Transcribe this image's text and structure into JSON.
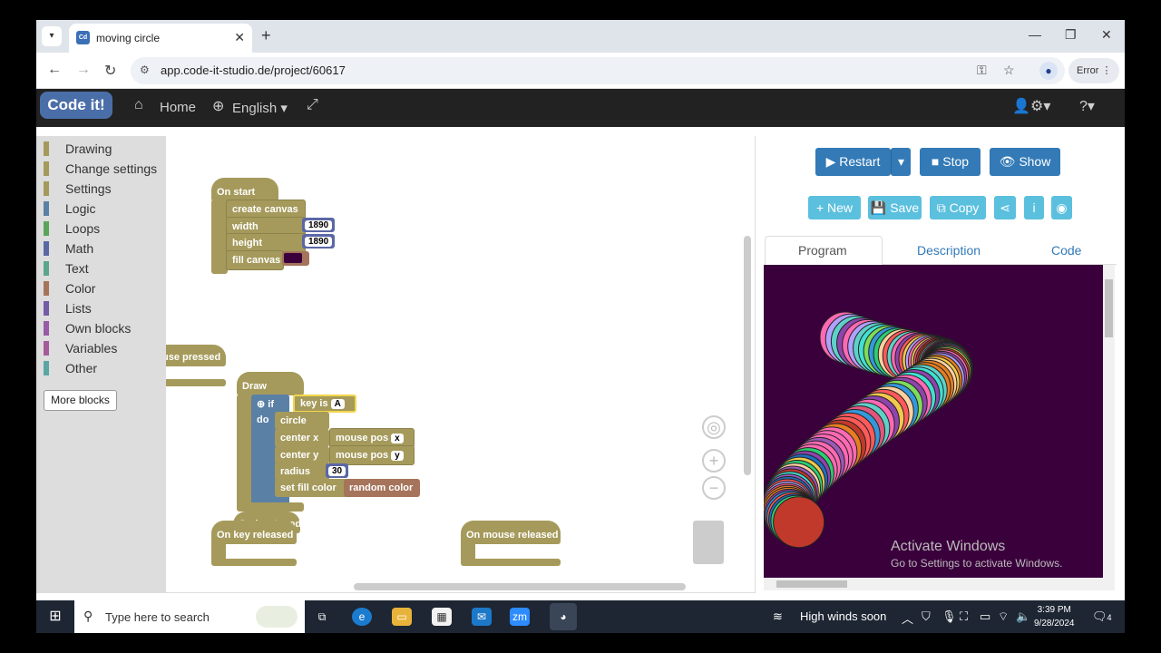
{
  "browser": {
    "tab_title": "moving circle",
    "url": "app.code-it-studio.de/project/60617",
    "error_label": "Error"
  },
  "appbar": {
    "logo": "Code it!",
    "home": "Home",
    "language": "English"
  },
  "toolbox": {
    "categories": [
      {
        "label": "Drawing",
        "color": "#a59a5b"
      },
      {
        "label": "Change settings",
        "color": "#a59a5b"
      },
      {
        "label": "Settings",
        "color": "#a59a5b"
      },
      {
        "label": "Logic",
        "color": "#5b80a5"
      },
      {
        "label": "Loops",
        "color": "#5ba55b"
      },
      {
        "label": "Math",
        "color": "#5b67a5"
      },
      {
        "label": "Text",
        "color": "#5ba58c"
      },
      {
        "label": "Color",
        "color": "#a5745b"
      },
      {
        "label": "Lists",
        "color": "#745ba5"
      },
      {
        "label": "Own blocks",
        "color": "#995ba5"
      },
      {
        "label": "Variables",
        "color": "#a55b99"
      },
      {
        "label": "Other",
        "color": "#5ba5a5"
      }
    ],
    "more_blocks": "More blocks"
  },
  "workspace": {
    "on_start": "On start",
    "create_canvas": "create canvas",
    "width": "width",
    "width_value": "1890",
    "height": "height",
    "height_value": "1890",
    "fill_canvas": "fill canvas",
    "mouse_pressed": "use pressed",
    "draw": "Draw",
    "if": "if",
    "key_is": "key is",
    "key_value": "A",
    "do": "do",
    "circle": "circle",
    "center_x": "center x",
    "center_y": "center y",
    "mouse_pos": "mouse pos",
    "mouse_pos_x": "x",
    "mouse_pos_y": "y",
    "radius": "radius",
    "radius_value": "30",
    "set_fill_color": "set fill color",
    "random_color": "random color",
    "on_key_typed": "On key typed",
    "on_key_released": "On key released",
    "on_mouse_released": "On mouse released"
  },
  "right_panel": {
    "restart": "Restart",
    "stop": "Stop",
    "show": "Show",
    "new": "New",
    "save": "Save",
    "copy": "Copy",
    "tabs": [
      "Program",
      "Description",
      "Code"
    ],
    "activate_title": "Activate Windows",
    "activate_sub": "Go to Settings to activate Windows."
  },
  "taskbar": {
    "search_placeholder": "Type here to search",
    "weather": "High winds soon",
    "time": "3:39 PM",
    "date": "9/28/2024",
    "notifications": "4"
  }
}
